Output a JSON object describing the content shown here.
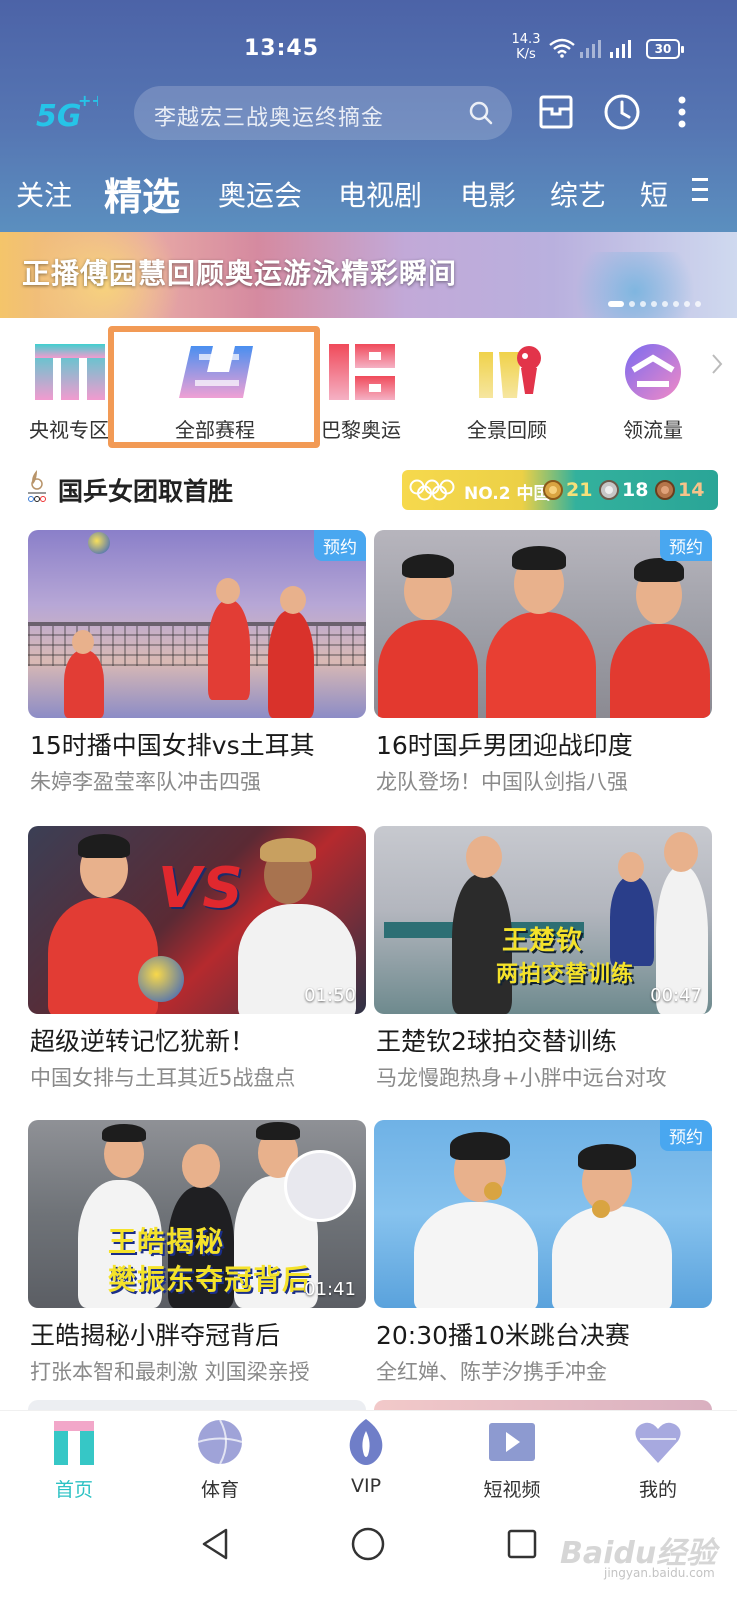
{
  "status_bar": {
    "time": "13:45",
    "net_speed_value": "14.3",
    "net_speed_unit": "K/s",
    "battery": "30"
  },
  "header": {
    "logo_icon": "5g-logo-icon",
    "search_placeholder": "李越宏三战奥运终摘金",
    "icons": [
      "search-icon",
      "message-box-icon",
      "history-clock-icon",
      "more-vertical-icon"
    ]
  },
  "tabs": [
    {
      "label": "关注",
      "active": false
    },
    {
      "label": "精选",
      "active": true
    },
    {
      "label": "奥运会",
      "active": false
    },
    {
      "label": "电视剧",
      "active": false
    },
    {
      "label": "电影",
      "active": false
    },
    {
      "label": "综艺",
      "active": false
    },
    {
      "label": "短",
      "active": false
    }
  ],
  "banner": {
    "title": "正播傅园慧回顾奥运游泳精彩瞬间",
    "page_count": 9,
    "active_index": 0
  },
  "quick_entries": [
    {
      "label": "央视专区",
      "icon": "cctv-zone-icon"
    },
    {
      "label": "全部赛程",
      "icon": "schedule-icon",
      "highlighted": true
    },
    {
      "label": "巴黎奥运",
      "icon": "paris-olympics-icon"
    },
    {
      "label": "全景回顾",
      "icon": "panorama-review-icon"
    },
    {
      "label": "领流量",
      "icon": "data-bonus-icon"
    }
  ],
  "section": {
    "title": "国乒女团取首胜",
    "rank_text": "NO.2 中国",
    "gold": "21",
    "silver": "18",
    "bronze": "14"
  },
  "cards": [
    {
      "title": "15时播中国女排vs土耳其",
      "subtitle": "朱婷李盈莹率队冲击四强",
      "badge": "预约",
      "duration": ""
    },
    {
      "title": "16时国乒男团迎战印度",
      "subtitle": "龙队登场！中国队剑指八强",
      "badge": "预约",
      "duration": ""
    },
    {
      "title": "超级逆转记忆犹新！",
      "subtitle": "中国女排与土耳其近5战盘点",
      "badge": "",
      "duration": "01:50",
      "overlay": "VS"
    },
    {
      "title": "王楚钦2球拍交替训练",
      "subtitle": "马龙慢跑热身+小胖中远台对攻",
      "badge": "",
      "duration": "00:47",
      "overlay_line1": "王楚钦",
      "overlay_line2": "两拍交替训练"
    },
    {
      "title": "王皓揭秘小胖夺冠背后",
      "subtitle": "打张本智和最刺激 刘国梁亲授",
      "badge": "",
      "duration": "01:41",
      "overlay_line1": "王皓揭秘",
      "overlay_line2": "樊振东夺冠背后"
    },
    {
      "title": "20:30播10米跳台决赛",
      "subtitle": "全红婵、陈芋汐携手冲金",
      "badge": "预约",
      "duration": ""
    }
  ],
  "bottom_nav": [
    {
      "label": "首页",
      "icon": "home-icon",
      "active": true
    },
    {
      "label": "体育",
      "icon": "sports-icon",
      "active": false
    },
    {
      "label": "VIP",
      "icon": "vip-icon",
      "active": false
    },
    {
      "label": "短视频",
      "icon": "short-video-icon",
      "active": false
    },
    {
      "label": "我的",
      "icon": "profile-heart-icon",
      "active": false
    }
  ],
  "watermark": {
    "text": "Baidu经验",
    "sub": "jingyan.baidu.com"
  }
}
